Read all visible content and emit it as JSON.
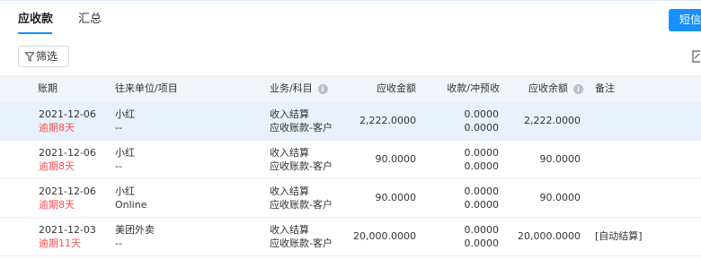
{
  "tabs": [
    {
      "label": "应收款",
      "active": true
    },
    {
      "label": "汇总",
      "active": false
    }
  ],
  "sms_button_label": "短信",
  "filter_button_label": "筛选",
  "accent_color": "#1890ff",
  "overdue_color": "#ff4d4f",
  "table": {
    "headers": {
      "date": "账期",
      "party": "往来单位/项目",
      "account": "业务/科目",
      "receivable": "应收金额",
      "collected": "收款/冲预收",
      "balance": "应收余额",
      "remark": "备注"
    },
    "rows": [
      {
        "date": "2021-12-06",
        "overdue": "逾期8天",
        "party": "小红",
        "project": "--",
        "business": "收入结算",
        "subject": "应收账款-客户",
        "receivable": "2,222.0000",
        "collected": "0.0000",
        "prepaid": "0.0000",
        "balance": "2,222.0000",
        "remark": "",
        "selected": true
      },
      {
        "date": "2021-12-06",
        "overdue": "逾期8天",
        "party": "小红",
        "project": "--",
        "business": "收入结算",
        "subject": "应收账款-客户",
        "receivable": "90.0000",
        "collected": "0.0000",
        "prepaid": "0.0000",
        "balance": "90.0000",
        "remark": "",
        "selected": false
      },
      {
        "date": "2021-12-06",
        "overdue": "逾期8天",
        "party": "小红",
        "project": "Online",
        "business": "收入结算",
        "subject": "应收账款-客户",
        "receivable": "90.0000",
        "collected": "0.0000",
        "prepaid": "0.0000",
        "balance": "90.0000",
        "remark": "",
        "selected": false
      },
      {
        "date": "2021-12-03",
        "overdue": "逾期11天",
        "party": "美团外卖",
        "project": "--",
        "business": "收入结算",
        "subject": "应收账款-客户",
        "receivable": "20,000.0000",
        "collected": "0.0000",
        "prepaid": "0.0000",
        "balance": "20,000.0000",
        "remark": "[自动结算]",
        "selected": false
      }
    ]
  }
}
